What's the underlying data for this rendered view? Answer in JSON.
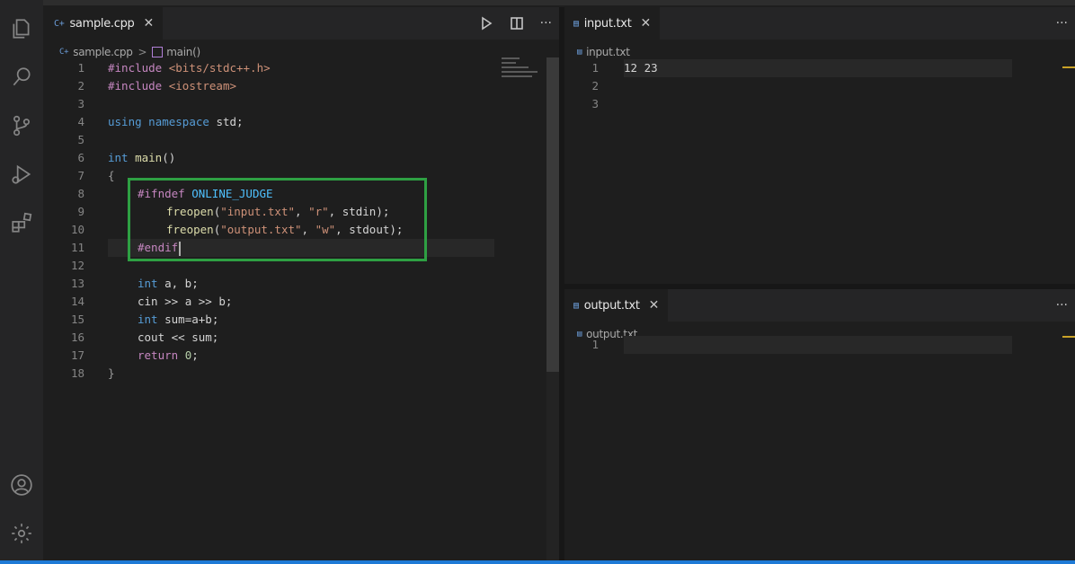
{
  "left_editor": {
    "tab": {
      "icon": "C+",
      "label": "sample.cpp",
      "close": "✕"
    },
    "actions": {
      "run": "run-icon",
      "split": "split-editor-icon",
      "more": "···"
    },
    "breadcrumb": {
      "icon": "C+",
      "file": "sample.cpp",
      "separator": ">",
      "symbol": "main()"
    },
    "lines": [
      {
        "n": "1"
      },
      {
        "n": "2"
      },
      {
        "n": "3"
      },
      {
        "n": "4"
      },
      {
        "n": "5"
      },
      {
        "n": "6"
      },
      {
        "n": "7"
      },
      {
        "n": "8"
      },
      {
        "n": "9"
      },
      {
        "n": "10"
      },
      {
        "n": "11"
      },
      {
        "n": "12"
      },
      {
        "n": "13"
      },
      {
        "n": "14"
      },
      {
        "n": "15"
      },
      {
        "n": "16"
      },
      {
        "n": "17"
      },
      {
        "n": "18"
      }
    ],
    "code": {
      "l1": [
        "#include",
        "<bits/stdc++.h>"
      ],
      "l2": [
        "#include",
        "<iostream>"
      ],
      "l4": [
        "using",
        "namespace",
        "std;"
      ],
      "l6": [
        "int",
        "main",
        "()"
      ],
      "l7": "{",
      "l8": [
        "#ifndef",
        "ONLINE_JUDGE"
      ],
      "l9": [
        "freopen",
        "(",
        "\"input.txt\"",
        ", ",
        "\"r\"",
        ", stdin);"
      ],
      "l10": [
        "freopen",
        "(",
        "\"output.txt\"",
        ", ",
        "\"w\"",
        ", stdout);"
      ],
      "l11": "#endif",
      "l13": [
        "int",
        " a, b;"
      ],
      "l14": [
        "cin",
        " >> ",
        "a",
        " >> ",
        "b",
        ";"
      ],
      "l15": [
        "int",
        " ",
        "sum",
        "=",
        "a",
        "+",
        "b",
        ";"
      ],
      "l16": [
        "cout",
        " << ",
        "sum",
        ";"
      ],
      "l17": [
        "return",
        " ",
        "0",
        ";"
      ],
      "l18": "}"
    }
  },
  "input_editor": {
    "tab": {
      "icon": "▤",
      "label": "input.txt",
      "close": "✕"
    },
    "more": "···",
    "breadcrumb": {
      "icon": "▤",
      "file": "input.txt"
    },
    "lines": [
      {
        "n": "1",
        "text": "12 23"
      },
      {
        "n": "2",
        "text": ""
      },
      {
        "n": "3",
        "text": ""
      }
    ]
  },
  "output_editor": {
    "tab": {
      "icon": "▤",
      "label": "output.txt",
      "close": "✕"
    },
    "more": "···",
    "breadcrumb": {
      "icon": "▤",
      "file": "output.txt"
    },
    "lines": [
      {
        "n": "1",
        "text": ""
      }
    ]
  },
  "colors": {
    "highlight_box": "#2ea043",
    "statusbar": "#1e7ad6",
    "keyword": "#569cd6",
    "preprocessor": "#c586c0",
    "string": "#ce9178"
  }
}
